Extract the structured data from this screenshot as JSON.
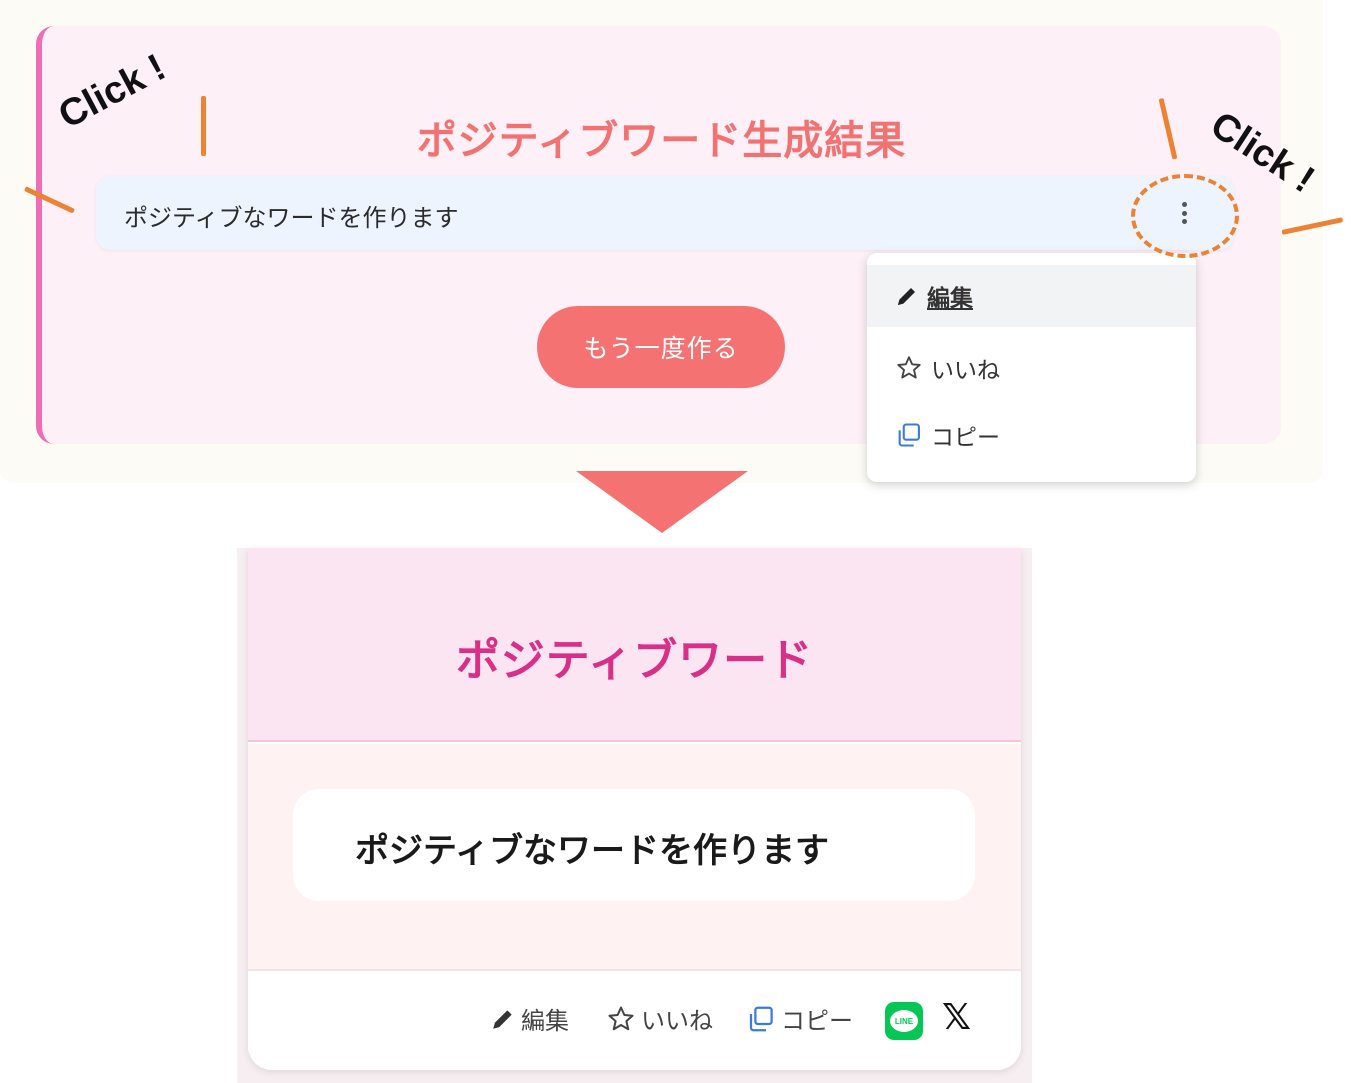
{
  "top": {
    "title": "ポジティブワード生成結果",
    "word": "ポジティブなワードを作ります",
    "retry_label": "もう一度作る",
    "menu": {
      "items": [
        {
          "label": "編集",
          "icon": "pencil-icon"
        },
        {
          "label": "いいね",
          "icon": "star-outline-icon"
        },
        {
          "label": "コピー",
          "icon": "copy-icon"
        }
      ]
    }
  },
  "annotations": {
    "click_left": "Click !",
    "click_right": "Click !",
    "accent_color": "#ec8233"
  },
  "bottom": {
    "title": "ポジティブワード",
    "word": "ポジティブなワードを作ります",
    "actions": [
      {
        "label": "編集",
        "icon": "pencil-icon"
      },
      {
        "label": "いいね",
        "icon": "star-outline-icon"
      },
      {
        "label": "コピー",
        "icon": "copy-icon"
      }
    ],
    "share": {
      "line_label": "LINE",
      "x_label": "𝕏"
    }
  },
  "colors": {
    "primary": "#f57272",
    "pink_accent": "#da2f86",
    "card_bg": "#fdf0f6",
    "line_green": "#06c755"
  }
}
